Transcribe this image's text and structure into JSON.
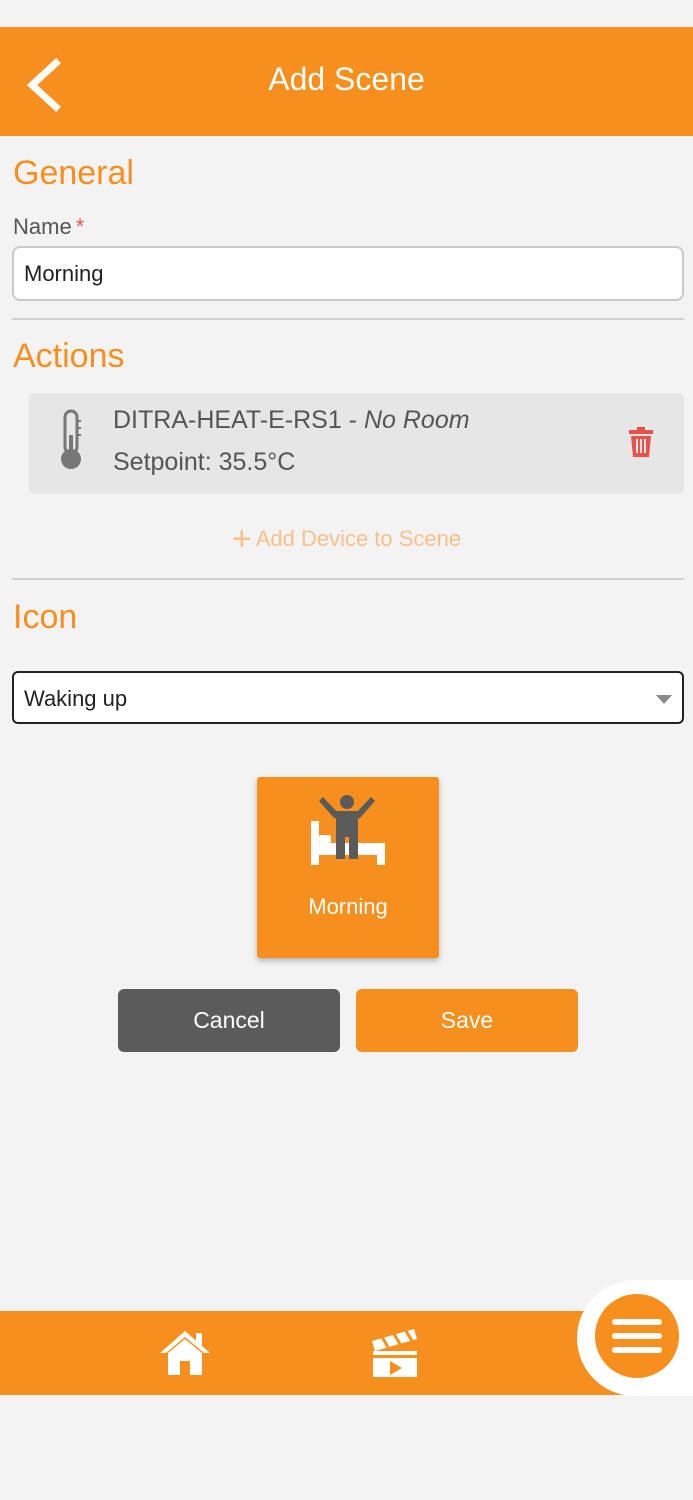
{
  "header": {
    "title": "Add Scene",
    "back_icon": "chevron-left-icon"
  },
  "general": {
    "section_title": "General",
    "name_label": "Name",
    "required_mark": "*",
    "name_value": "Morning"
  },
  "actions": {
    "section_title": "Actions",
    "items": [
      {
        "device": "DITRA-HEAT-E-RS1",
        "separator": " - ",
        "room": "No Room",
        "detail": "Setpoint: 35.5°C",
        "icon": "thermometer-icon",
        "delete_icon": "trash-icon"
      }
    ],
    "add_device_label": "Add Device to Scene",
    "add_plus": "+"
  },
  "icon": {
    "section_title": "Icon",
    "selected_option": "Waking up"
  },
  "preview": {
    "label": "Morning",
    "icon": "waking-up-icon"
  },
  "buttons": {
    "cancel_label": "Cancel",
    "save_label": "Save"
  },
  "nav": {
    "home_icon": "home-icon",
    "scenes_icon": "clapperboard-icon",
    "menu_icon": "hamburger-menu-icon"
  },
  "colors": {
    "accent": "#f78f1e",
    "cancel": "#5b5b5b",
    "delete": "#e9524a",
    "background": "#f3f3f3"
  }
}
